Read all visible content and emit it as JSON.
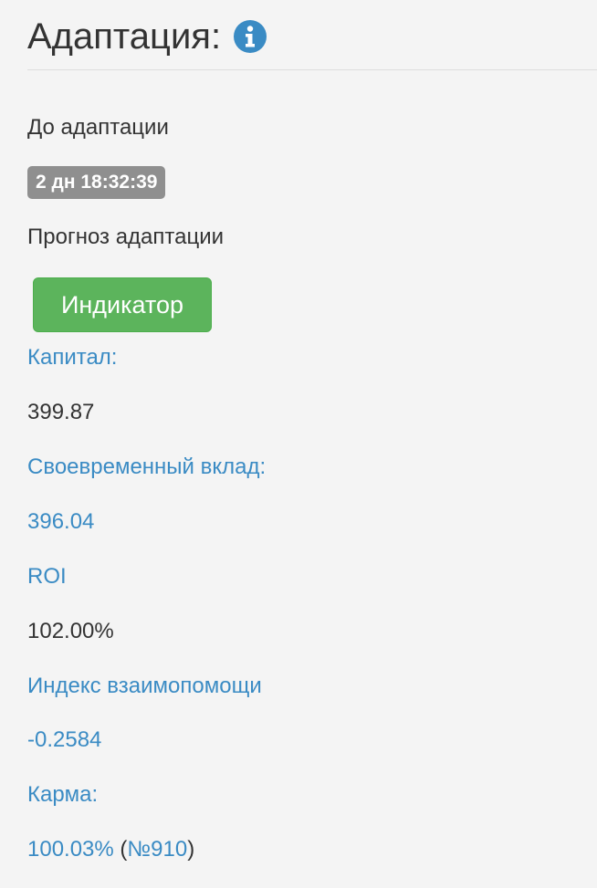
{
  "header": {
    "title": "Адаптация:",
    "info_icon": "info-circle-icon",
    "info_icon_color": "#3a8bc4"
  },
  "adaptation": {
    "before_label": "До адаптации",
    "countdown": "2 дн 18:32:39",
    "forecast_label": "Прогноз адаптации",
    "indicator_button": "Индикатор",
    "indicator_color": "#5cb45c"
  },
  "stats": {
    "capital_label": "Капитал:",
    "capital_value": "399.87",
    "deposit_label": "Своевременный вклад:",
    "deposit_value": "396.04",
    "roi_label": "ROI",
    "roi_value": "102.00%",
    "mutual_aid_label": "Индекс взаимопомощи",
    "mutual_aid_value": "-0.2584",
    "karma_label": "Карма:",
    "karma_value": "100.03%",
    "karma_rank_open": " (",
    "karma_rank": "№910",
    "karma_rank_close": ")"
  },
  "colors": {
    "link": "#3a8bc4",
    "text": "#333333",
    "background": "#f4f4f4",
    "badge": "#8f8f8f"
  }
}
